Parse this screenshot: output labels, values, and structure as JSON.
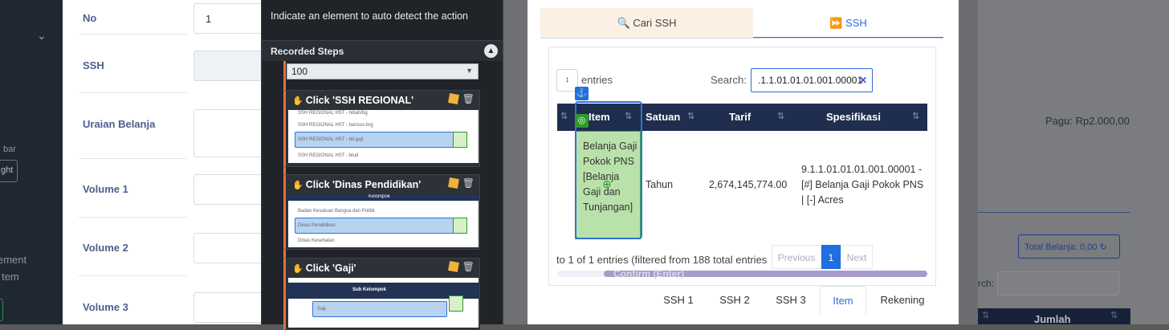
{
  "sidebar": {
    "frag1": "bar",
    "frag2": "ght",
    "frag3": "ement",
    "frag4": "tem"
  },
  "form": {
    "no_label": "No",
    "no_value": "1",
    "ssh_label": "SSH",
    "uraian_label": "Uraian Belanja",
    "volume1_label": "Volume 1",
    "volume2_label": "Volume 2",
    "volume3_label": "Volume 3"
  },
  "recorder": {
    "hint": "Indicate an element to auto detect the action",
    "header": "Recorded Steps",
    "select_value": "100",
    "steps": [
      {
        "title": "Click 'SSH REGIONAL'",
        "thumb": [
          "SSH REGIONAL HST - hibah/bg",
          "SSH REGIONAL HST - bansos-brg",
          "SSH REGIONAL HST - btl-gaji",
          "SSH REGIONAL HST - btud"
        ]
      },
      {
        "title": "Click 'Dinas Pendidikan'",
        "thumb": [
          "Kelompok",
          "Badan Kesatuan Bangsa dan Politik",
          "Dinas Pendidikan",
          "Dinas Kesehatan"
        ]
      },
      {
        "title": "Click 'Gaji'",
        "thumb": [
          "Sub Kelompok",
          "Gaji"
        ]
      }
    ]
  },
  "ssh": {
    "tab_cari": "Cari SSH",
    "tab_ssh": "SSH",
    "length_label": "entries",
    "search_label": "Search:",
    "search_value": ".1.1.01.01.01.001.00001",
    "columns": [
      "Item",
      "Satuan",
      "Tarif",
      "Spesifikasi"
    ],
    "row": {
      "item": "Belanja Gaji Pokok PNS [Belanja Gaji dan Tunjangan]",
      "satuan": "Tahun",
      "tarif": "2,674,145,774.00",
      "spesifikasi": "9.1.1.01.01.01.001.00001 - [#] Belanja Gaji Pokok PNS | [-] Acres"
    },
    "info": "to 1 of 1 entries (filtered from 188 total entries",
    "pager": {
      "prev": "Previous",
      "page": "1",
      "next": "Next"
    },
    "ghost": "Confirm (Enter)",
    "bottom_tabs": [
      "SSH 1",
      "SSH 2",
      "SSH 3",
      "Item",
      "Rekening"
    ]
  },
  "right": {
    "pagu": "Pagu: Rp2.000,00",
    "total": "Total Belanja: 0,00",
    "search_label": "rch:",
    "jumlah": "Jumlah"
  }
}
